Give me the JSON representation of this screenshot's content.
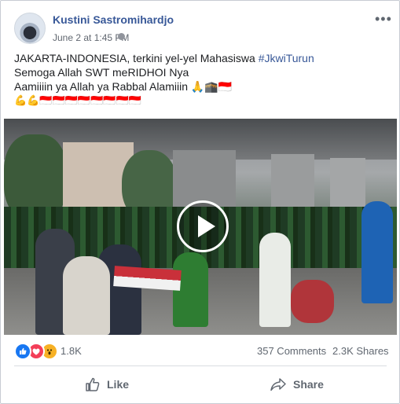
{
  "post": {
    "author": "Kustini Sastromihardjo",
    "timestamp": "June 2 at 1:45 PM",
    "text": {
      "line1_prefix": "JAKARTA-INDONESIA, terkini yel-yel Mahasiswa ",
      "hashtag": "#JkwiTurun",
      "line2": "Semoga Allah SWT meRIDHOI Nya",
      "line3": "Aamiiiin ya Allah ya Rabbal Alamiiin 🙏🕋🇮🇩",
      "line4": "💪💪🇮🇩🇮🇩🇮🇩🇮🇩🇮🇩🇮🇩🇮🇩🇮🇩"
    }
  },
  "icons": {
    "more": "more-options-icon",
    "globe": "globe-icon",
    "play": "play-icon",
    "like_reaction": "like-reaction-icon",
    "love_reaction": "love-reaction-icon",
    "wow_reaction": "wow-reaction-icon",
    "like_action": "thumbs-up-icon",
    "share_action": "share-arrow-icon"
  },
  "stats": {
    "reactions": "1.8K",
    "comments": "357 Comments",
    "shares": "2.3K Shares"
  },
  "actions": {
    "like": "Like",
    "share": "Share"
  },
  "colors": {
    "author": "#385898",
    "hashtag": "#385898",
    "secondary_text": "#606770",
    "like_reaction": "#1877f2",
    "love_reaction": "#f33e58",
    "wow_reaction": "#f7b125"
  }
}
